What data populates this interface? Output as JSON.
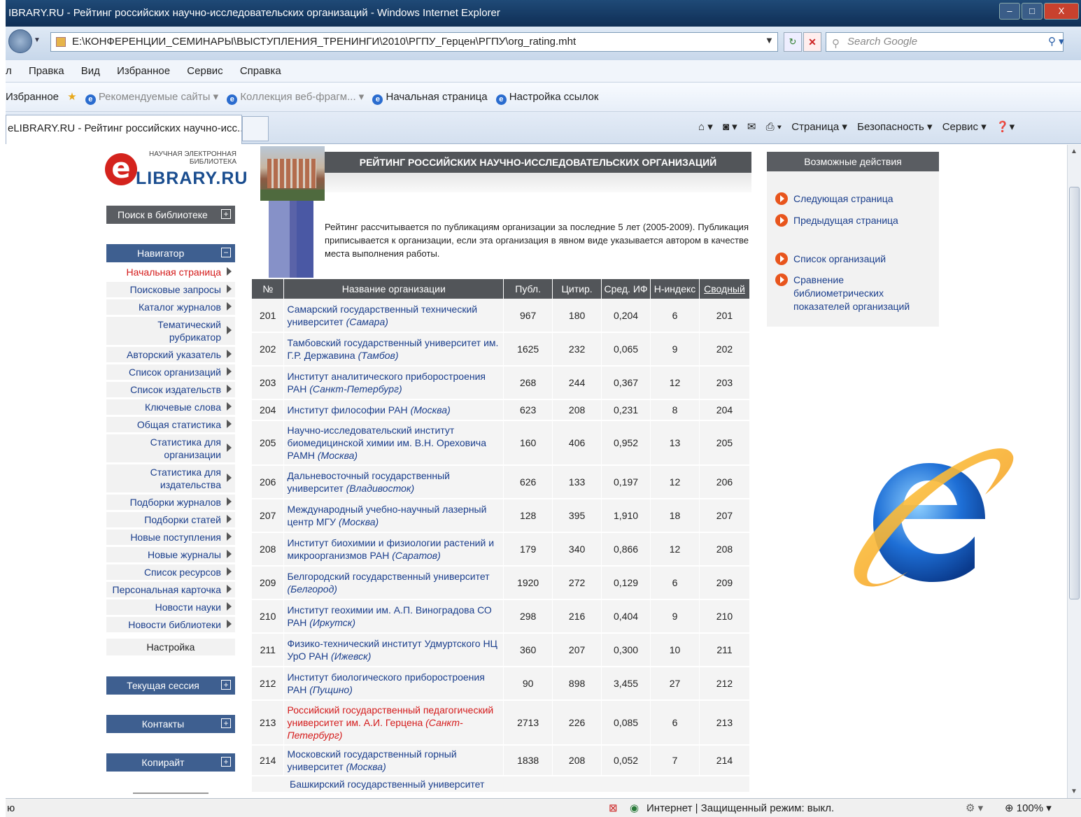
{
  "window": {
    "title": "IBRARY.RU - Рейтинг российских научно-исследовательских организаций - Windows Internet Explorer",
    "controls": {
      "minimize": "–",
      "maximize": "□",
      "close": "X"
    }
  },
  "address": {
    "url": "E:\\КОНФЕРЕНЦИИ_СЕМИНАРЫ\\ВЫСТУПЛЕНИЯ_ТРЕНИНГИ\\2010\\РГПУ_Герцен\\РГПУ\\org_rating.mht",
    "search_placeholder": "Search Google"
  },
  "menu": [
    "л",
    "Правка",
    "Вид",
    "Избранное",
    "Сервис",
    "Справка"
  ],
  "favorites": {
    "label": "Избранное",
    "items": [
      "Рекомендуемые сайты ▾",
      "Коллекция веб-фрагм... ▾",
      "Начальная страница",
      "Настройка ссылок"
    ]
  },
  "tab": {
    "title": "eLIBRARY.RU - Рейтинг российских научно-исс..."
  },
  "commands": [
    "Страница ▾",
    "Безопасность ▾",
    "Сервис ▾"
  ],
  "logo": {
    "line1": "НАУЧНАЯ ЭЛЕКТРОННАЯ",
    "line2": "БИБЛИОТЕКА",
    "brand": "LIBRARY.RU"
  },
  "sidebar": {
    "search": "Поиск в библиотеке",
    "navigator": "Навигатор",
    "items": [
      "Начальная страница",
      "Поисковые запросы",
      "Каталог журналов",
      "Тематический рубрикатор",
      "Авторский указатель",
      "Список организаций",
      "Список издательств",
      "Ключевые слова",
      "Общая статистика",
      "Статистика для организации",
      "Статистика для издательства",
      "Подборки журналов",
      "Подборки статей",
      "Новые поступления",
      "Новые журналы",
      "Список ресурсов",
      "Персональная карточка",
      "Новости науки",
      "Новости библиотеки"
    ],
    "settings": "Настройка",
    "session": "Текущая сессия",
    "contacts": "Контакты",
    "copyright": "Копирайт"
  },
  "main": {
    "heading": "РЕЙТИНГ РОССИЙСКИХ НАУЧНО-ИССЛЕДОВАТЕЛЬСКИХ ОРГАНИЗАЦИЙ",
    "description": "Рейтинг рассчитывается по публикациям организации за последние 5 лет (2005-2009). Публикация приписывается к организации, если эта организация в явном виде указывается автором в качестве места выполнения работы.",
    "columns": [
      "№",
      "Название организации",
      "Публ.",
      "Цитир.",
      "Сред. ИФ",
      "Н-индекс",
      "Сводный"
    ],
    "rows": [
      {
        "n": "201",
        "name": "Самарский государственный технический университет",
        "city": "(Самара)",
        "pub": "967",
        "cit": "180",
        "if": "0,204",
        "h": "6",
        "sum": "201"
      },
      {
        "n": "202",
        "name": "Тамбовский государственный университет им. Г.Р. Державина",
        "city": "(Тамбов)",
        "pub": "1625",
        "cit": "232",
        "if": "0,065",
        "h": "9",
        "sum": "202"
      },
      {
        "n": "203",
        "name": "Институт аналитического приборостроения РАН",
        "city": "(Санкт-Петербург)",
        "pub": "268",
        "cit": "244",
        "if": "0,367",
        "h": "12",
        "sum": "203"
      },
      {
        "n": "204",
        "name": "Институт философии РАН",
        "city": "(Москва)",
        "pub": "623",
        "cit": "208",
        "if": "0,231",
        "h": "8",
        "sum": "204"
      },
      {
        "n": "205",
        "name": "Научно-исследовательский институт биомедицинской химии им. В.Н. Ореховича РАМН",
        "city": "(Москва)",
        "pub": "160",
        "cit": "406",
        "if": "0,952",
        "h": "13",
        "sum": "205"
      },
      {
        "n": "206",
        "name": "Дальневосточный государственный университет",
        "city": "(Владивосток)",
        "pub": "626",
        "cit": "133",
        "if": "0,197",
        "h": "12",
        "sum": "206"
      },
      {
        "n": "207",
        "name": "Международный учебно-научный лазерный центр МГУ",
        "city": "(Москва)",
        "pub": "128",
        "cit": "395",
        "if": "1,910",
        "h": "18",
        "sum": "207"
      },
      {
        "n": "208",
        "name": "Институт биохимии и физиологии растений и микроорганизмов РАН",
        "city": "(Саратов)",
        "pub": "179",
        "cit": "340",
        "if": "0,866",
        "h": "12",
        "sum": "208"
      },
      {
        "n": "209",
        "name": "Белгородский государственный университет",
        "city": "(Белгород)",
        "pub": "1920",
        "cit": "272",
        "if": "0,129",
        "h": "6",
        "sum": "209"
      },
      {
        "n": "210",
        "name": "Институт геохимии им. А.П. Виноградова СО РАН",
        "city": "(Иркутск)",
        "pub": "298",
        "cit": "216",
        "if": "0,404",
        "h": "9",
        "sum": "210"
      },
      {
        "n": "211",
        "name": "Физико-технический институт Удмуртского НЦ УрО РАН",
        "city": "(Ижевск)",
        "pub": "360",
        "cit": "207",
        "if": "0,300",
        "h": "10",
        "sum": "211"
      },
      {
        "n": "212",
        "name": "Институт биологического приборостроения РАН",
        "city": "(Пущино)",
        "pub": "90",
        "cit": "898",
        "if": "3,455",
        "h": "27",
        "sum": "212"
      },
      {
        "n": "213",
        "name": "Российский государственный педагогический университет им. А.И. Герцена",
        "city": "(Санкт-Петербург)",
        "pub": "2713",
        "cit": "226",
        "if": "0,085",
        "h": "6",
        "sum": "213",
        "highlight": true
      },
      {
        "n": "214",
        "name": "Московский государственный горный университет",
        "city": "(Москва)",
        "pub": "1838",
        "cit": "208",
        "if": "0,052",
        "h": "7",
        "sum": "214"
      }
    ],
    "cut_row": "Башкирский государственный университет"
  },
  "actions": {
    "title": "Возможные действия",
    "items": [
      "Следующая страница",
      "Предыдущая страница",
      "Список организаций",
      "Сравнение библиометрических показателей организаций"
    ]
  },
  "status": {
    "left": "ю",
    "zone": "Интернет | Защищенный режим: выкл.",
    "zoom": "100%"
  },
  "colors": {
    "accent": "#3e5f90",
    "header": "#525559",
    "link": "#1a3e8c",
    "highlight": "#d41a1a",
    "action_dot": "#e8551d"
  }
}
